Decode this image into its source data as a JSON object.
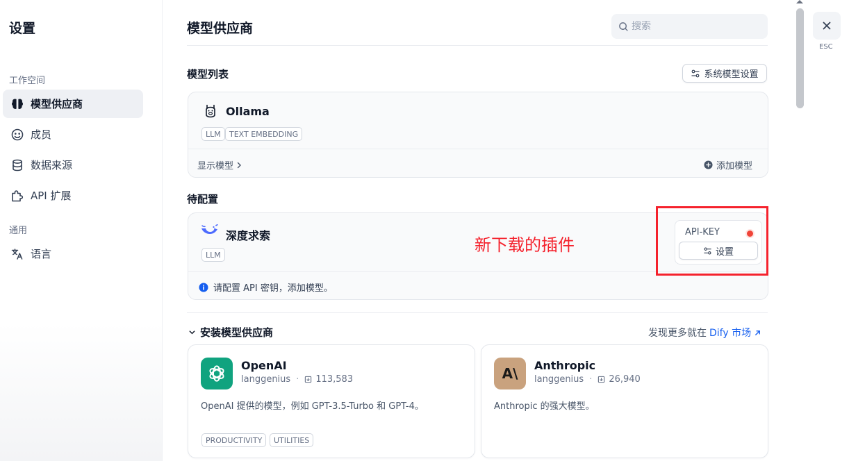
{
  "sidebar": {
    "title": "设置",
    "workspace_label": "工作空间",
    "general_label": "通用",
    "items": [
      {
        "label": "模型供应商",
        "icon": "brain-icon"
      },
      {
        "label": "成员",
        "icon": "members-icon"
      },
      {
        "label": "数据来源",
        "icon": "database-icon"
      },
      {
        "label": "API 扩展",
        "icon": "puzzle-icon"
      },
      {
        "label": "语言",
        "icon": "translate-icon"
      }
    ]
  },
  "header": {
    "title": "模型供应商",
    "search_placeholder": "搜索"
  },
  "model_list": {
    "title": "模型列表",
    "system_settings_label": "系统模型设置",
    "providers": [
      {
        "name": "Ollama",
        "icon": "llama-icon",
        "tags": [
          "LLM",
          "TEXT EMBEDDING"
        ],
        "show_models": "显示模型",
        "add_model": "添加模型"
      }
    ]
  },
  "pending": {
    "title": "待配置",
    "providers": [
      {
        "name": "深度求索",
        "icon": "deepseek-whale-icon",
        "tags": [
          "LLM"
        ],
        "api_key_label": "API-KEY",
        "settings_label": "设置",
        "notice": "请配置 API 密钥，添加模型。",
        "status_color": "#f04438"
      }
    ]
  },
  "annotation": {
    "text": "新下载的插件",
    "color": "#f5222d"
  },
  "install": {
    "title": "安装模型供应商",
    "market_prefix": "发现更多就在",
    "market_link": "Dify 市场",
    "cards": [
      {
        "name": "OpenAI",
        "author": "langgenius",
        "downloads": "113,583",
        "description": "OpenAI 提供的模型，例如 GPT-3.5-Turbo 和 GPT-4。",
        "tags": [
          "PRODUCTIVITY",
          "UTILITIES"
        ],
        "logo_color": "#10a37f",
        "icon": "openai-icon"
      },
      {
        "name": "Anthropic",
        "author": "langgenius",
        "downloads": "26,940",
        "description": "Anthropic 的强大模型。",
        "tags": [],
        "logo_color": "#c9a27e",
        "logo_text": "A\\",
        "icon": "anthropic-icon"
      }
    ]
  },
  "esc": {
    "label": "ESC"
  },
  "colors": {
    "accent": "#155eef",
    "annotation_red": "#f5222d"
  }
}
